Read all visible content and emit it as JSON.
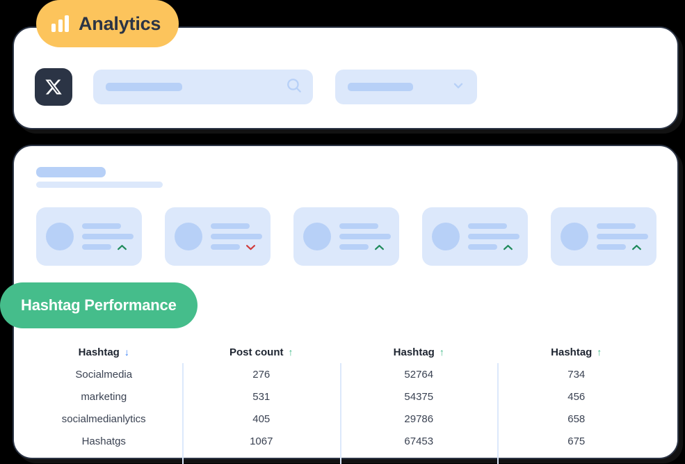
{
  "badges": {
    "analytics": {
      "label": "Analytics",
      "icon": "bar-chart-icon",
      "bg": "#fcc45c",
      "text_color": "#2b3445"
    },
    "hashtag_performance": {
      "label": "Hashtag Performance",
      "bg": "#45bd8b",
      "text_color": "#ffffff"
    }
  },
  "toolbar": {
    "platform_icon": "x-twitter-icon",
    "platform_tile_bg": "#2b3445",
    "search": {
      "icon": "search-icon",
      "placeholder": "",
      "value": ""
    },
    "filter_dropdown": {
      "icon": "chevron-down-icon",
      "value": ""
    }
  },
  "main": {
    "title": "",
    "subtitle": "",
    "stat_cards": [
      {
        "trend": "up",
        "trend_color": "#1e8a5a"
      },
      {
        "trend": "down",
        "trend_color": "#d13b3b"
      },
      {
        "trend": "up",
        "trend_color": "#1e8a5a"
      },
      {
        "trend": "up",
        "trend_color": "#1e8a5a"
      },
      {
        "trend": "up",
        "trend_color": "#1e8a5a"
      }
    ]
  },
  "table": {
    "columns": [
      {
        "label": "Hashtag",
        "sort": "desc",
        "arrow": "↓",
        "arrow_color": "#3b82f6"
      },
      {
        "label": "Post count",
        "sort": "asc",
        "arrow": "↑",
        "arrow_color": "#3cb886"
      },
      {
        "label": "Hashtag",
        "sort": "asc",
        "arrow": "↑",
        "arrow_color": "#3cb886"
      },
      {
        "label": "Hashtag",
        "sort": "asc",
        "arrow": "↑",
        "arrow_color": "#3cb886"
      }
    ],
    "rows": [
      [
        "Socialmedia",
        "276",
        "52764",
        "734"
      ],
      [
        "marketing",
        "531",
        "54375",
        "456"
      ],
      [
        "socialmedianlytics",
        "405",
        "29786",
        "658"
      ],
      [
        "Hashatgs",
        "1067",
        "67453",
        "675"
      ]
    ]
  },
  "colors": {
    "page_bg": "#000000",
    "panel_bg": "#ffffff",
    "panel_border": "#2b3445",
    "skeleton_light": "#dce8fb",
    "skeleton_dark": "#b7d0f7",
    "accent_amber": "#fcc45c",
    "accent_green": "#45bd8b"
  }
}
